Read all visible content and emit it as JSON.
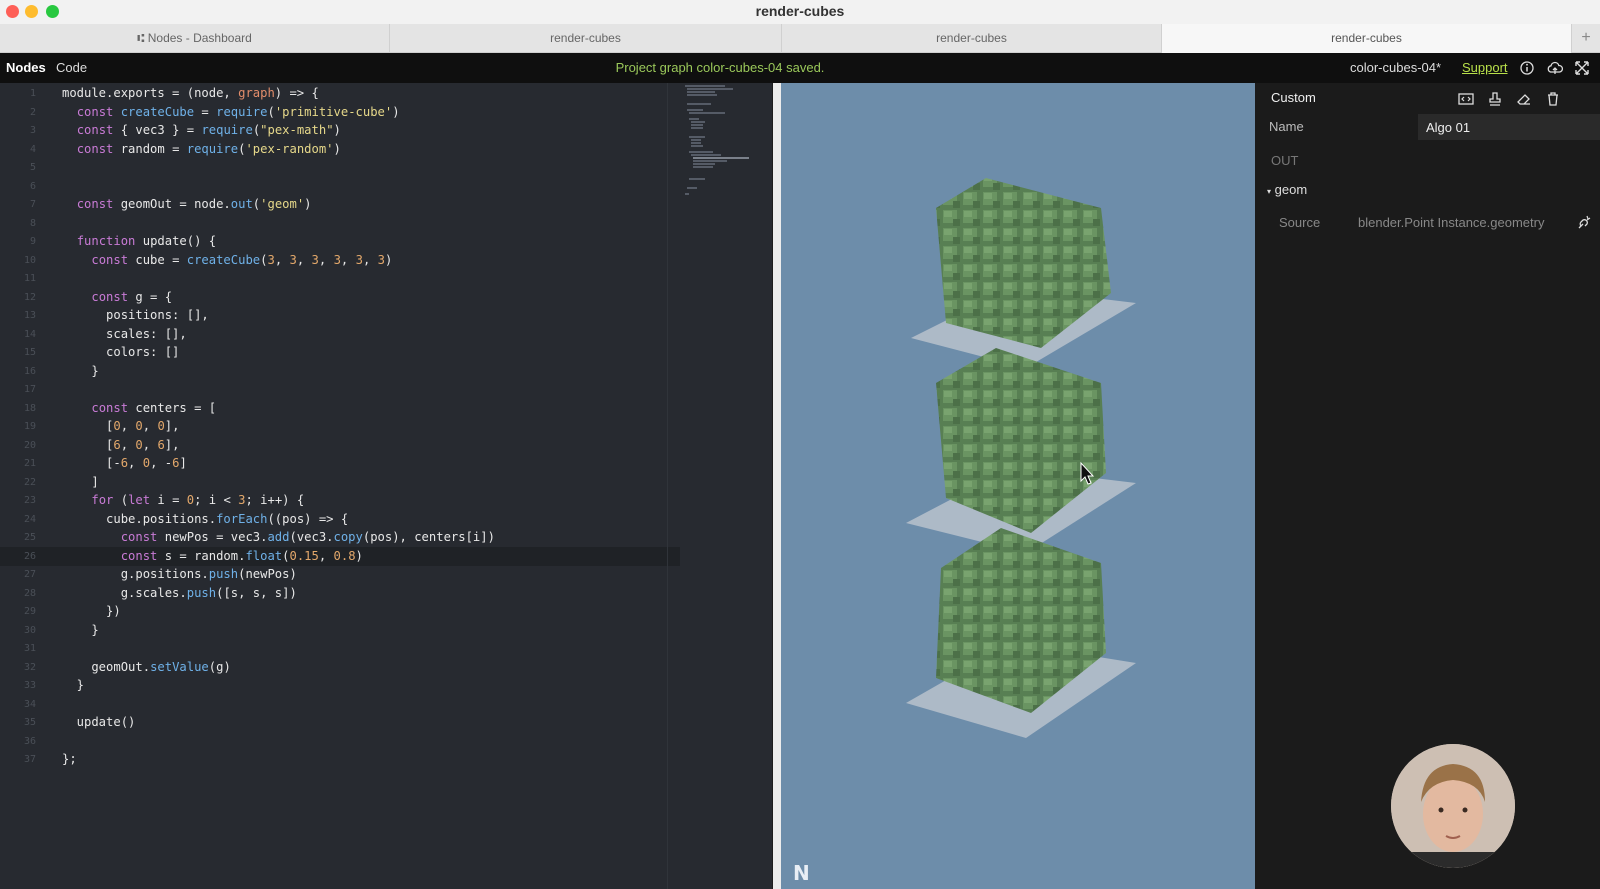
{
  "window": {
    "title": "render-cubes"
  },
  "tabs": [
    {
      "label": "⑆ Nodes - Dashboard",
      "active": false
    },
    {
      "label": "render-cubes",
      "active": false
    },
    {
      "label": "render-cubes",
      "active": false
    },
    {
      "label": "render-cubes",
      "active": true
    }
  ],
  "tab_add": "+",
  "toolbar": {
    "nodes": "Nodes",
    "code": "Code",
    "status": "Project graph color-cubes-04 saved.",
    "project": "color-cubes-04*",
    "support": "Support"
  },
  "editor": {
    "lines": [
      {
        "n": "1",
        "code": "module.exports = (node, graph) => {"
      },
      {
        "n": "2",
        "code": "  const createCube = require('primitive-cube')"
      },
      {
        "n": "3",
        "code": "  const { vec3 } = require(\"pex-math\")"
      },
      {
        "n": "4",
        "code": "  const random = require('pex-random')"
      },
      {
        "n": "5",
        "code": ""
      },
      {
        "n": "6",
        "code": ""
      },
      {
        "n": "7",
        "code": "  const geomOut = node.out('geom')"
      },
      {
        "n": "8",
        "code": ""
      },
      {
        "n": "9",
        "code": "  function update() {"
      },
      {
        "n": "10",
        "code": "    const cube = createCube(3, 3, 3, 3, 3, 3)"
      },
      {
        "n": "11",
        "code": ""
      },
      {
        "n": "12",
        "code": "    const g = {"
      },
      {
        "n": "13",
        "code": "      positions: [],"
      },
      {
        "n": "14",
        "code": "      scales: [],"
      },
      {
        "n": "15",
        "code": "      colors: []"
      },
      {
        "n": "16",
        "code": "    }"
      },
      {
        "n": "17",
        "code": ""
      },
      {
        "n": "18",
        "code": "    const centers = ["
      },
      {
        "n": "19",
        "code": "      [0, 0, 0],"
      },
      {
        "n": "20",
        "code": "      [6, 0, 6],"
      },
      {
        "n": "21",
        "code": "      [-6, 0, -6]"
      },
      {
        "n": "22",
        "code": "    ]"
      },
      {
        "n": "23",
        "code": "    for (let i = 0; i < 3; i++) {"
      },
      {
        "n": "24",
        "code": "      cube.positions.forEach((pos) => {"
      },
      {
        "n": "25",
        "code": "        const newPos = vec3.add(vec3.copy(pos), centers[i])"
      },
      {
        "n": "26",
        "code": "        const s = random.float(0.15, 0.8)"
      },
      {
        "n": "27",
        "code": "        g.positions.push(newPos)"
      },
      {
        "n": "28",
        "code": "        g.scales.push([s, s, s])"
      },
      {
        "n": "29",
        "code": "      })"
      },
      {
        "n": "30",
        "code": "    }"
      },
      {
        "n": "31",
        "code": ""
      },
      {
        "n": "32",
        "code": "    geomOut.setValue(g)"
      },
      {
        "n": "33",
        "code": "  }"
      },
      {
        "n": "34",
        "code": ""
      },
      {
        "n": "35",
        "code": "  update()"
      },
      {
        "n": "36",
        "code": ""
      },
      {
        "n": "37",
        "code": "};"
      }
    ],
    "highlighted_line": "26"
  },
  "viewport": {
    "logo": "N",
    "background": "#6d8daa",
    "cube_color": "#5f8a5a"
  },
  "inspector": {
    "title": "Custom",
    "name_label": "Name",
    "name_value": "Algo 01",
    "out_label": "OUT",
    "port_name": "geom",
    "source_label": "Source",
    "source_value": "blender.Point Instance.geometry"
  },
  "colors": {
    "accent_green": "#9ac85a",
    "support_link": "#b8e04a"
  }
}
